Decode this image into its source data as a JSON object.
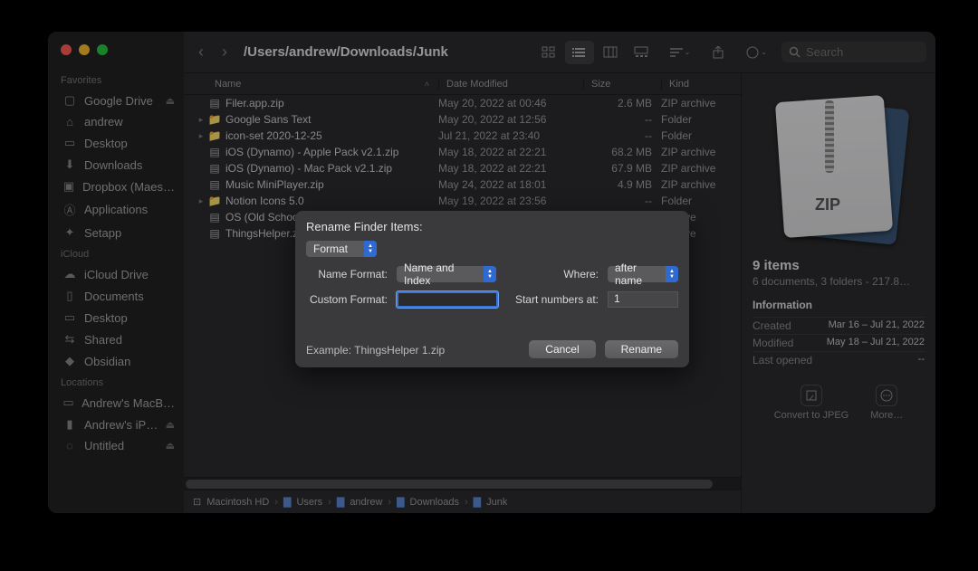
{
  "sidebar": {
    "sections": [
      {
        "title": "Favorites",
        "items": [
          {
            "icon": "folder",
            "label": "Google Drive",
            "eject": true
          },
          {
            "icon": "home",
            "label": "andrew"
          },
          {
            "icon": "desktop",
            "label": "Desktop"
          },
          {
            "icon": "download",
            "label": "Downloads"
          },
          {
            "icon": "dropbox",
            "label": "Dropbox (Maes…"
          },
          {
            "icon": "apps",
            "label": "Applications"
          },
          {
            "icon": "setapp",
            "label": "Setapp"
          }
        ]
      },
      {
        "title": "iCloud",
        "items": [
          {
            "icon": "cloud",
            "label": "iCloud Drive"
          },
          {
            "icon": "doc",
            "label": "Documents"
          },
          {
            "icon": "desktop",
            "label": "Desktop"
          },
          {
            "icon": "shared",
            "label": "Shared"
          },
          {
            "icon": "obsidian",
            "label": "Obsidian"
          }
        ]
      },
      {
        "title": "Locations",
        "items": [
          {
            "icon": "laptop",
            "label": "Andrew's MacB…"
          },
          {
            "icon": "phone",
            "label": "Andrew's iP…",
            "eject": true
          },
          {
            "icon": "disk",
            "label": "Untitled",
            "eject": true
          }
        ]
      }
    ]
  },
  "toolbar": {
    "path_title": "/Users/andrew/Downloads/Junk",
    "search_placeholder": "Search"
  },
  "columns": {
    "name": "Name",
    "date": "Date Modified",
    "size": "Size",
    "kind": "Kind"
  },
  "files": [
    {
      "disc": "",
      "icon": "zip",
      "name": "Filer.app.zip",
      "date": "May 20, 2022 at 00:46",
      "size": "2.6 MB",
      "kind": "ZIP archive"
    },
    {
      "disc": "▸",
      "icon": "folder",
      "name": "Google Sans Text",
      "date": "May 20, 2022 at 12:56",
      "size": "--",
      "kind": "Folder"
    },
    {
      "disc": "▸",
      "icon": "folder",
      "name": "icon-set 2020-12-25",
      "date": "Jul 21, 2022 at 23:40",
      "size": "--",
      "kind": "Folder"
    },
    {
      "disc": "",
      "icon": "zip",
      "name": "iOS (Dynamo) - Apple Pack v2.1.zip",
      "date": "May 18, 2022 at 22:21",
      "size": "68.2 MB",
      "kind": "ZIP archive"
    },
    {
      "disc": "",
      "icon": "zip",
      "name": "iOS (Dynamo) - Mac Pack v2.1.zip",
      "date": "May 18, 2022 at 22:21",
      "size": "67.9 MB",
      "kind": "ZIP archive"
    },
    {
      "disc": "",
      "icon": "zip",
      "name": "Music MiniPlayer.zip",
      "date": "May 24, 2022 at 18:01",
      "size": "4.9 MB",
      "kind": "ZIP archive"
    },
    {
      "disc": "▸",
      "icon": "folder",
      "name": "Notion Icons 5.0",
      "date": "May 19, 2022 at 23:56",
      "size": "--",
      "kind": "Folder"
    },
    {
      "disc": "",
      "icon": "zip",
      "name": "OS (Old School",
      "date": "",
      "size": "",
      "kind": "archive"
    },
    {
      "disc": "",
      "icon": "zip",
      "name": "ThingsHelper.z",
      "date": "",
      "size": "",
      "kind": "archive"
    }
  ],
  "preview": {
    "ziplabel": "ZIP",
    "title": "9 items",
    "subtitle": "6 documents, 3 folders - 217.8…",
    "info_header": "Information",
    "created_label": "Created",
    "created": "Mar 16 – Jul 21, 2022",
    "modified_label": "Modified",
    "modified": "May 18 – Jul 21, 2022",
    "lastopened_label": "Last opened",
    "lastopened": "--",
    "action_convert": "Convert to JPEG",
    "action_more": "More…"
  },
  "pathbar": [
    "Macintosh HD",
    "Users",
    "andrew",
    "Downloads",
    "Junk"
  ],
  "modal": {
    "title": "Rename Finder Items:",
    "mode": "Format",
    "nameformat_label": "Name Format:",
    "nameformat_value": "Name and Index",
    "where_label": "Where:",
    "where_value": "after name",
    "customformat_label": "Custom Format:",
    "customformat_value": "",
    "startnumbers_label": "Start numbers at:",
    "startnumbers_value": "1",
    "example": "Example: ThingsHelper 1.zip",
    "cancel": "Cancel",
    "rename": "Rename"
  }
}
